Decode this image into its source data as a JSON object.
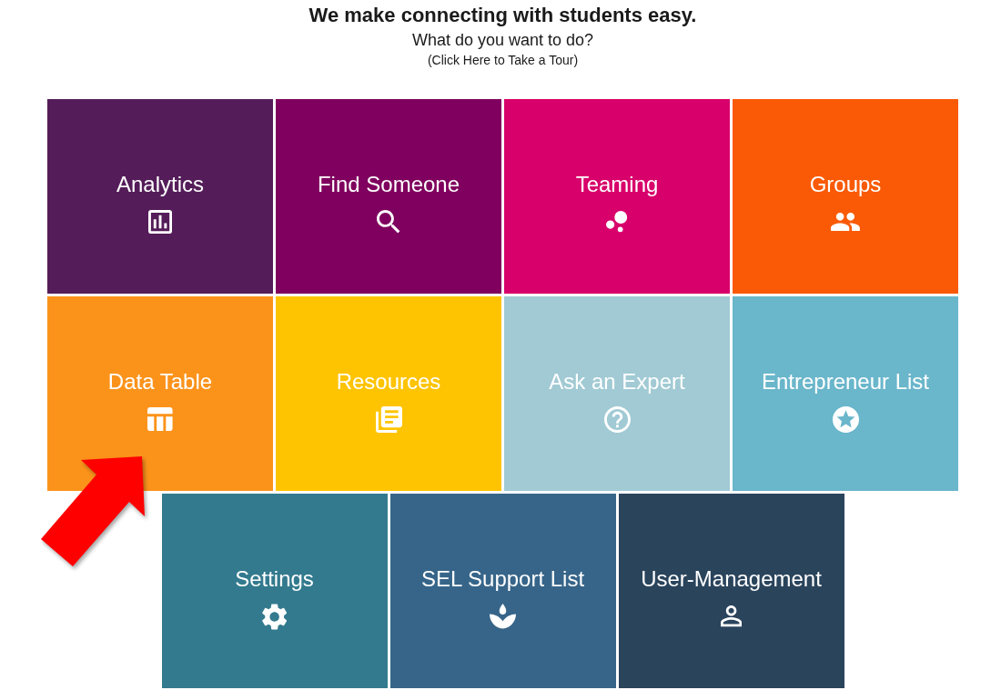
{
  "header": {
    "title": "We make connecting with students easy.",
    "subtitle": "What do you want to do?",
    "tour_link": "(Click Here to Take a Tour)"
  },
  "tiles": [
    {
      "label": "Analytics",
      "color": "#541d59",
      "pointed_at": false
    },
    {
      "label": "Find Someone",
      "color": "#7f005e",
      "pointed_at": false
    },
    {
      "label": "Teaming",
      "color": "#d8006a",
      "pointed_at": false
    },
    {
      "label": "Groups",
      "color": "#fa5a05",
      "pointed_at": false
    },
    {
      "label": "Data Table",
      "color": "#fb931b",
      "pointed_at": true
    },
    {
      "label": "Resources",
      "color": "#fec401",
      "pointed_at": false
    },
    {
      "label": "Ask an Expert",
      "color": "#a1cad4",
      "pointed_at": false
    },
    {
      "label": "Entrepreneur List",
      "color": "#6ab6cb",
      "pointed_at": false
    },
    {
      "label": "Settings",
      "color": "#337a8e",
      "pointed_at": false
    },
    {
      "label": "SEL Support List",
      "color": "#376589",
      "pointed_at": false
    },
    {
      "label": "User-Management",
      "color": "#2a445c",
      "pointed_at": false
    }
  ]
}
